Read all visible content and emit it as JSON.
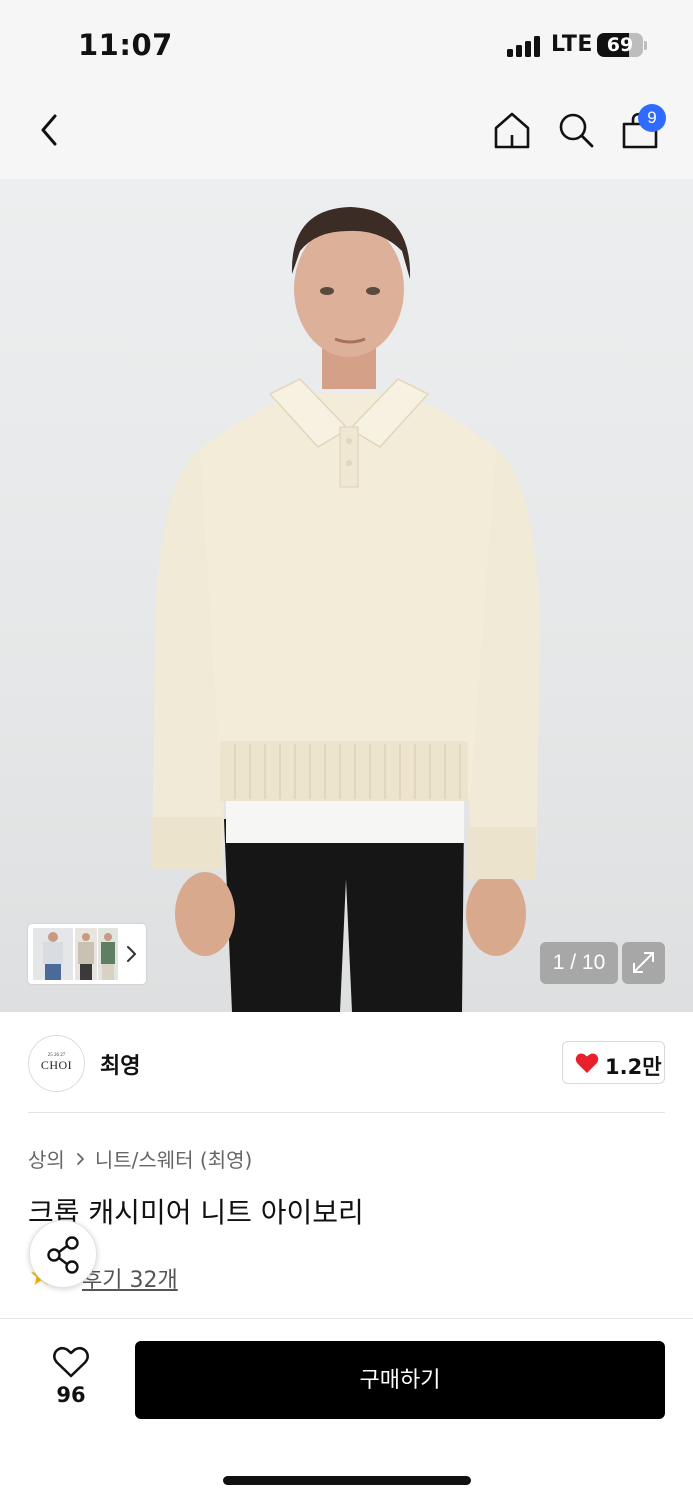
{
  "status_bar": {
    "time": "11:07",
    "network": "LTE",
    "battery_percent": "69",
    "battery_level": 0.69
  },
  "nav": {
    "cart_badge": "9",
    "badge_color": "#2f6bff"
  },
  "gallery": {
    "counter": "1 / 10",
    "current_image": 1,
    "total_images": 10
  },
  "brand": {
    "logo_top": "25 26 27",
    "logo_text": "CHOI",
    "name": "최영",
    "like_count": "1.2만"
  },
  "product": {
    "breadcrumb": [
      "상의",
      "니트/스웨터 (최영)"
    ],
    "title": "크롭 캐시미어 니트 아이보리",
    "review_label": "후기 32개"
  },
  "bottom_bar": {
    "wish_count": "96",
    "buy_label": "구매하기"
  },
  "colors": {
    "accent_blue": "#2f6bff",
    "heart_red": "#e8202b",
    "star_yellow": "#f5b800",
    "buy_button": "#000000"
  },
  "icons": [
    "back-chevron-icon",
    "home-icon",
    "search-icon",
    "shopping-bag-icon",
    "expand-icon",
    "heart-icon",
    "share-icon",
    "star-icon"
  ]
}
